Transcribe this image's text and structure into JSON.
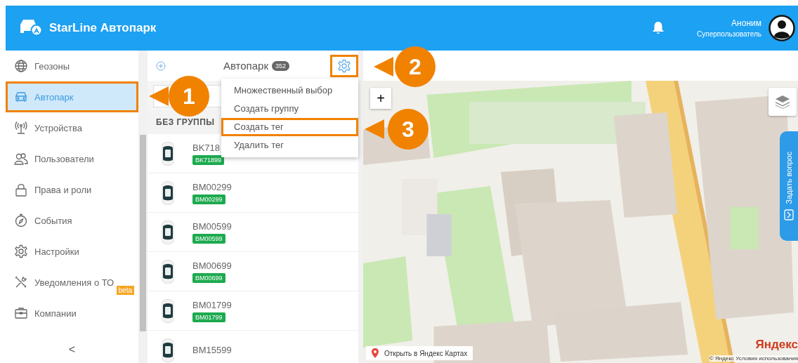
{
  "header": {
    "app_title": "StarLine Автопарк",
    "user": {
      "name": "Аноним",
      "role": "Суперпользователь"
    }
  },
  "sidebar": {
    "items": [
      {
        "label": "Геозоны",
        "selected": false,
        "highlighted": false
      },
      {
        "label": "Автопарк",
        "selected": true,
        "highlighted": true
      },
      {
        "label": "Устройства",
        "selected": false,
        "highlighted": false
      },
      {
        "label": "Пользователи",
        "selected": false,
        "highlighted": false
      },
      {
        "label": "Права и роли",
        "selected": false,
        "highlighted": false
      },
      {
        "label": "События",
        "selected": false,
        "highlighted": false
      },
      {
        "label": "Настройки",
        "selected": false,
        "highlighted": false
      },
      {
        "label": "Уведомления о ТО",
        "selected": false,
        "highlighted": false,
        "badge": "beta"
      },
      {
        "label": "Компании",
        "selected": false,
        "highlighted": false
      }
    ],
    "collapse": "<"
  },
  "fleet_panel": {
    "title": "Автопарк",
    "count": "352",
    "settings_highlighted": true,
    "group": "БЕЗ ГРУППЫ",
    "vehicles": [
      {
        "name": "BK718",
        "tag": "BK71899"
      },
      {
        "name": "BM00299",
        "tag": "BM00299"
      },
      {
        "name": "BM00599",
        "tag": "BM00599"
      },
      {
        "name": "BM00699",
        "tag": "BM00699"
      },
      {
        "name": "BM01799",
        "tag": "BM01799"
      },
      {
        "name": "BM15599"
      }
    ]
  },
  "menu": {
    "items": [
      {
        "label": "Множественный выбор",
        "highlighted": false
      },
      {
        "label": "Создать группу",
        "highlighted": false
      },
      {
        "label": "Создать тег",
        "highlighted": true
      },
      {
        "label": "Удалить тег",
        "highlighted": false
      }
    ]
  },
  "map": {
    "zoom_in": "+",
    "open_link": "Открыть в Яндекс Картах",
    "ask_tab": "Задать вопрос",
    "logo": "Яндекс",
    "terms": "© Яндекс  Условия использования"
  },
  "callouts": [
    {
      "label": "1"
    },
    {
      "label": "2"
    },
    {
      "label": "3"
    }
  ]
}
